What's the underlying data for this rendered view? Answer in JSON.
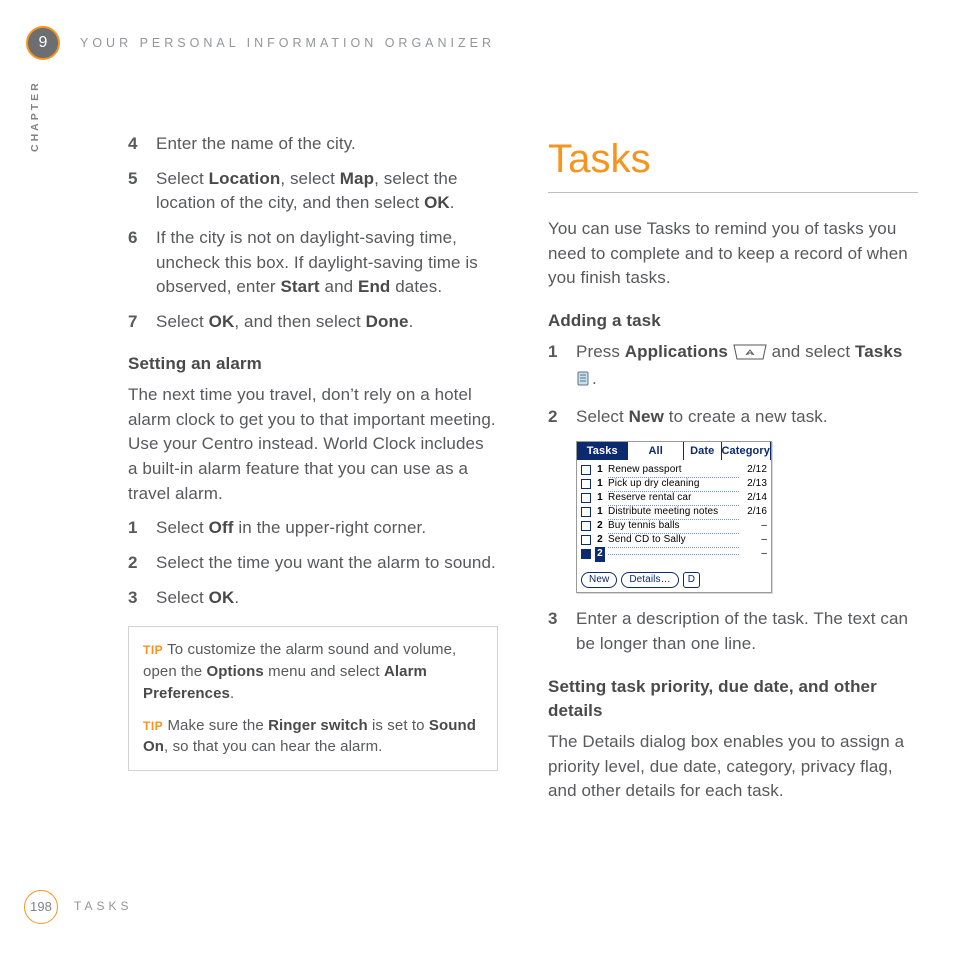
{
  "chapter": {
    "number": "9",
    "label": "CHAPTER",
    "header": "YOUR PERSONAL INFORMATION ORGANIZER"
  },
  "left": {
    "steps_a": [
      {
        "n": "4",
        "html": "Enter the name of the city."
      },
      {
        "n": "5",
        "html": "Select <b>Location</b>, select <b>Map</b>, select the location of the city, and then select <b>OK</b>."
      },
      {
        "n": "6",
        "html": "If the city is not on daylight-saving time, uncheck this box. If daylight-saving time is observed, enter <b>Start</b> and <b>End</b> dates."
      },
      {
        "n": "7",
        "html": "Select <b>OK</b>, and then select <b>Done</b>."
      }
    ],
    "alarm_heading": "Setting an alarm",
    "alarm_para": "The next time you travel, don’t rely on a hotel alarm clock to get you to that important meeting. Use your Centro instead. World Clock includes a built-in alarm feature that you can use as a travel alarm.",
    "steps_b": [
      {
        "n": "1",
        "html": "Select <b>Off</b> in the upper-right corner."
      },
      {
        "n": "2",
        "html": "Select the time you want the alarm to sound."
      },
      {
        "n": "3",
        "html": "Select <b>OK</b>."
      }
    ],
    "tips": [
      {
        "label": "TIP",
        "html": "To customize the alarm sound and volume, open the <b>Options</b> menu and select <b>Alarm Preferences</b>."
      },
      {
        "label": "TIP",
        "html": "Make sure the <b>Ringer switch</b> is set to <b>Sound On</b>, so that you can hear the alarm."
      }
    ]
  },
  "right": {
    "section_title": "Tasks",
    "intro": "You can use Tasks to remind you of tasks you need to complete and to keep a record of when you finish tasks.",
    "adding_heading": "Adding a task",
    "steps_add": [
      {
        "n": "1",
        "html": "Press <b>Applications</b> ICON_HOME and select <b>Tasks</b> ICON_TASKS."
      },
      {
        "n": "2",
        "html": "Select <b>New</b> to create a new task."
      }
    ],
    "step3": {
      "n": "3",
      "html": "Enter a description of the task. The text can be longer than one line."
    },
    "priority_heading": "Setting task priority, due date, and other details",
    "priority_para": "The Details dialog box enables you to assign a priority level, due date, category, privacy flag, and other details for each task."
  },
  "tasks_screenshot": {
    "title": "Tasks",
    "tabs": {
      "all": "All",
      "date": "Date",
      "category": "Category"
    },
    "rows": [
      {
        "pri": "1",
        "name": "Renew passport",
        "due": "2/12"
      },
      {
        "pri": "1",
        "name": "Pick up dry cleaning",
        "due": "2/13"
      },
      {
        "pri": "1",
        "name": "Reserve rental car",
        "due": "2/14"
      },
      {
        "pri": "1",
        "name": "Distribute meeting notes",
        "due": "2/16"
      },
      {
        "pri": "2",
        "name": "Buy tennis balls",
        "due": "–"
      },
      {
        "pri": "2",
        "name": "Send CD to Sally",
        "due": "–"
      },
      {
        "pri": "2",
        "name": "",
        "due": "–",
        "selected": true
      }
    ],
    "buttons": {
      "new": "New",
      "details": "Details…",
      "note": "D"
    }
  },
  "footer": {
    "page": "198",
    "label": "TASKS"
  }
}
